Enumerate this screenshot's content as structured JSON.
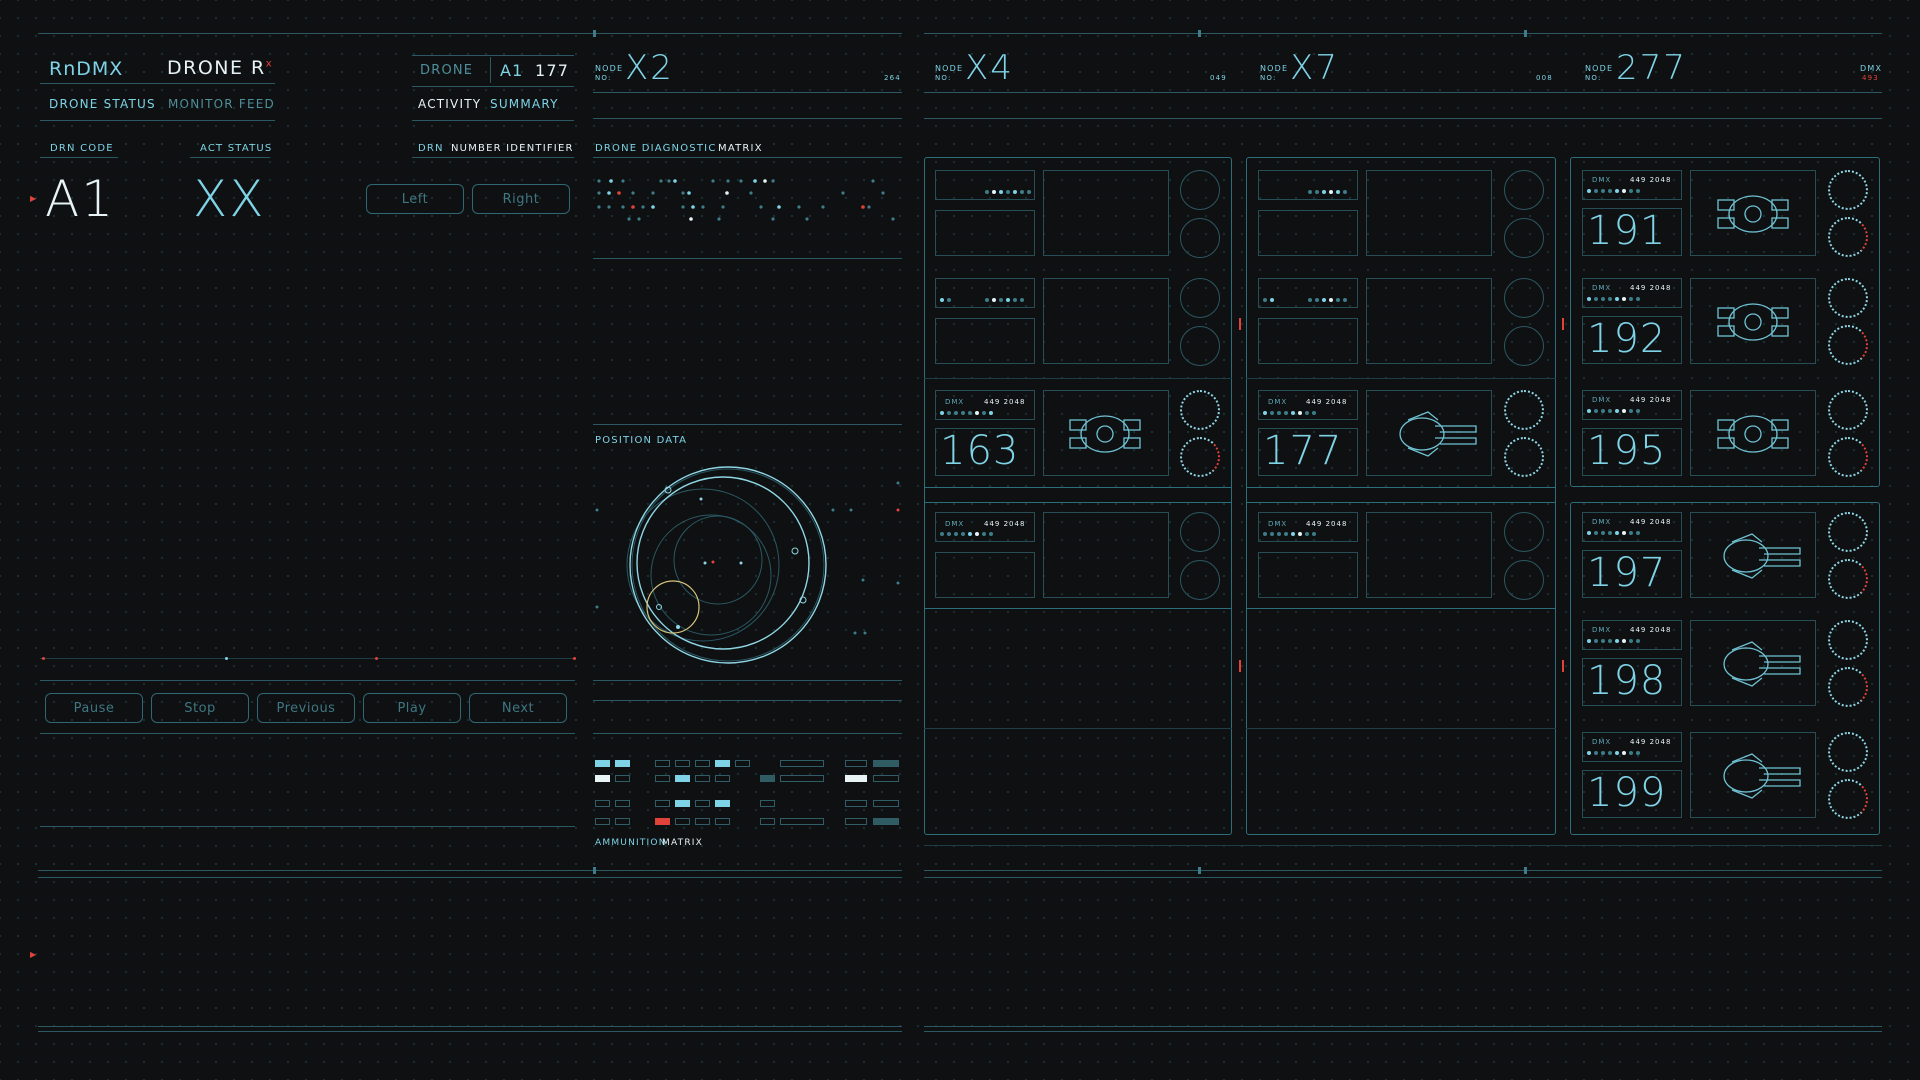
{
  "header": {
    "brand": "RnDMX",
    "drone_title": "DRONE R",
    "drone_title_sup": "x",
    "drone_box_label": "DRONE",
    "drone_box_code": "A1",
    "drone_box_num": "177",
    "tab_status": "DRONE STATUS",
    "tab_monitor": "MONITOR FEED",
    "activity": "ACTIVITY",
    "summary": "SUMMARY"
  },
  "status": {
    "col_code": "DRN CODE",
    "col_act": "ACT STATUS",
    "col_drn": "DRN",
    "col_number": "NUMBER IDENTIFIER",
    "code_value": "A1",
    "act_value": "XX"
  },
  "controls": {
    "left": "Left",
    "right": "Right",
    "pause": "Pause",
    "stop": "Stop",
    "previous": "Previous",
    "play": "Play",
    "next": "Next"
  },
  "mid": {
    "node_label": "NODE",
    "node_no": "NO:",
    "node_value": "X2",
    "node_side": "264",
    "diag_title_a": "DRONE DIAGNOSTIC",
    "diag_title_b": "MATRIX",
    "position_title": "POSITION DATA",
    "ammo_title_a": "AMMUNITION",
    "ammo_title_b": "MATRIX"
  },
  "nodes": [
    {
      "label": "NODE",
      "no": "NO:",
      "value": "X4",
      "side": "049"
    },
    {
      "label": "NODE",
      "no": "NO:",
      "value": "X7",
      "side": "008"
    },
    {
      "label": "NODE",
      "no": "NO:",
      "value": "277",
      "side": ""
    }
  ],
  "dmx_corner": {
    "label": "DMX",
    "value": "493"
  },
  "cards": {
    "dmx_label": "DMX",
    "dmx_value": "449 2048",
    "col1": {
      "num1": "163"
    },
    "col2": {
      "num1": "177"
    },
    "col3": {
      "nums": [
        "191",
        "192",
        "195",
        "197",
        "198",
        "199"
      ]
    }
  },
  "colors": {
    "accent": "#7fd3e6",
    "alert": "#e0433a",
    "text_white": "#e8f3f5",
    "line": "#2b5862"
  },
  "icons": [
    "drone-bot-icon",
    "gunship-icon"
  ]
}
